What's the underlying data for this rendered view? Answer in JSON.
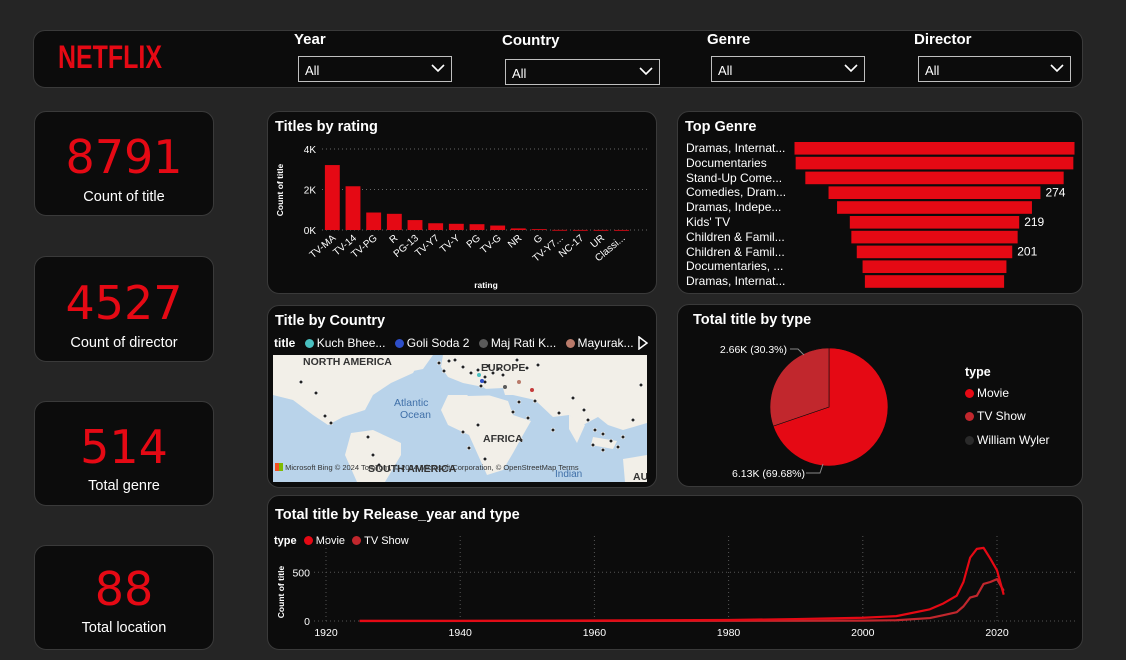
{
  "header": {
    "logo": "NETFLIX",
    "filters": [
      {
        "label": "Year",
        "value": "All"
      },
      {
        "label": "Country",
        "value": "All"
      },
      {
        "label": "Genre",
        "value": "All"
      },
      {
        "label": "Director",
        "value": "All"
      }
    ]
  },
  "kpis": [
    {
      "value": "8791",
      "label": "Count of title"
    },
    {
      "value": "4527",
      "label": "Count of director"
    },
    {
      "value": "514",
      "label": "Total genre"
    },
    {
      "value": "88",
      "label": "Total location"
    }
  ],
  "colors": {
    "accent": "#e50914",
    "tvshow": "#c1272d",
    "background": "#252525",
    "panel": "#0c0c0c"
  },
  "map": {
    "title": "Title by Country",
    "legend_title": "title",
    "legend": [
      {
        "name": "Kuch Bhee...",
        "color": "#49bfbf"
      },
      {
        "name": "Goli Soda 2",
        "color": "#2e4fc9"
      },
      {
        "name": "Maj Rati K...",
        "color": "#5a5a5a"
      },
      {
        "name": "Mayurak...",
        "color": "#b97a6a"
      }
    ],
    "labels": {
      "north_america": "NORTH AMERICA",
      "europe": "EUROPE",
      "atlantic": "Atlantic",
      "ocean": "Ocean",
      "africa": "AFRICA",
      "south_america": "SOUTH AMERICA",
      "indian": "Indian",
      "au": "AU"
    },
    "attribution": "Microsoft Bing",
    "copyright": "© 2024 TomTom, © 2024 Microsoft Corporation, © OpenStreetMap  Terms"
  },
  "chart_data": [
    {
      "type": "bar",
      "title": "Titles by rating",
      "xlabel": "rating",
      "ylabel": "Count of title",
      "ylim": [
        0,
        4000
      ],
      "yticks": [
        {
          "v": 0,
          "label": "0K"
        },
        {
          "v": 2000,
          "label": "2K"
        },
        {
          "v": 4000,
          "label": "4K"
        }
      ],
      "categories": [
        "TV-MA",
        "TV-14",
        "TV-PG",
        "R",
        "PG-13",
        "TV-Y7",
        "TV-Y",
        "PG",
        "TV-G",
        "NR",
        "G",
        "TV-Y7...",
        "NC-17",
        "UR",
        "Classi..."
      ],
      "shown_labels": [
        "TV-MA",
        "TV-14",
        "TV-PG",
        "R",
        "PG-13",
        "TV-Y7",
        "TV-Y",
        "PG",
        "TV-G",
        "NR",
        "G",
        "TV-Y7...",
        "NC-17",
        "UR",
        "Classi..."
      ],
      "values": [
        3207,
        2160,
        863,
        799,
        490,
        333,
        306,
        287,
        220,
        79,
        41,
        6,
        3,
        3,
        2
      ],
      "grid": true
    },
    {
      "type": "bar",
      "title": "Top Genre",
      "orientation": "funnel",
      "categories": [
        "Dramas, Internat...",
        "Documentaries",
        "Stand-Up Come...",
        "Comedies, Dram...",
        "Dramas, Indepe...",
        "Kids' TV",
        "Children & Famil...",
        "Children & Famil...",
        "Documentaries, ...",
        "Dramas, Internat..."
      ],
      "values": [
        362,
        359,
        334,
        274,
        252,
        219,
        215,
        201,
        186,
        180
      ],
      "data_labels": {
        "3": "274",
        "5": "219",
        "7": "201"
      }
    },
    {
      "type": "pie",
      "title": "Total title by type",
      "legend_title": "type",
      "legend": [
        {
          "name": "Movie",
          "color": "#e50914"
        },
        {
          "name": "TV Show",
          "color": "#c1272d"
        },
        {
          "name": "William Wyler",
          "color": "#2a2a2a"
        }
      ],
      "slices": [
        {
          "name": "Movie",
          "value": 6130,
          "percent": 69.68,
          "label": "6.13K (69.68%)"
        },
        {
          "name": "TV Show",
          "value": 2660,
          "percent": 30.3,
          "label": "2.66K (30.3%)"
        }
      ]
    },
    {
      "type": "line",
      "title": "Total title by Release_year and type",
      "legend_title": "type",
      "ylabel": "Count of title",
      "xlim": [
        1917,
        2033
      ],
      "ylim": [
        0,
        800
      ],
      "xticks": [
        1920,
        1940,
        1960,
        1980,
        2000,
        2020
      ],
      "yticks": [
        0,
        500
      ],
      "grid": true,
      "series": [
        {
          "name": "Movie",
          "color": "#e50914",
          "x": [
            1925,
            1940,
            1960,
            1980,
            1990,
            2000,
            2005,
            2010,
            2012,
            2014,
            2015,
            2016,
            2017,
            2018,
            2019,
            2020,
            2021
          ],
          "y": [
            1,
            2,
            5,
            10,
            20,
            33,
            50,
            120,
            180,
            260,
            400,
            650,
            740,
            750,
            640,
            520,
            270
          ]
        },
        {
          "name": "TV Show",
          "color": "#c1272d",
          "x": [
            1925,
            1960,
            1990,
            2000,
            2005,
            2010,
            2012,
            2014,
            2015,
            2016,
            2017,
            2018,
            2019,
            2020,
            2021
          ],
          "y": [
            0,
            1,
            2,
            4,
            8,
            30,
            60,
            90,
            150,
            240,
            260,
            380,
            400,
            430,
            310
          ]
        }
      ]
    }
  ]
}
